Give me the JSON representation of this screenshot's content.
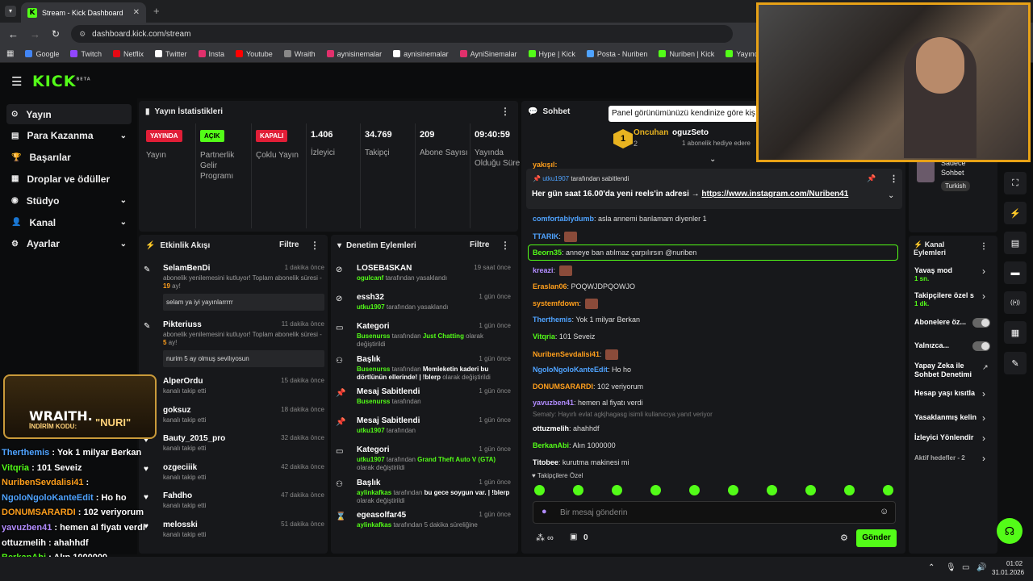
{
  "browser": {
    "tab_title": "Stream - Kick Dashboard",
    "url": "dashboard.kick.com/stream",
    "bookmarks": [
      "Google",
      "Twitch",
      "Netflix",
      "Twitter",
      "Insta",
      "Youtube",
      "Wraith",
      "aynisinemalar",
      "aynisinemalar",
      "AyniSinemalar",
      "Hype | Kick",
      "Posta - Nuriben",
      "Nuriben | Kick",
      "Yayıncı Paneli | Kick"
    ]
  },
  "brand": "KICK",
  "brand_sup": "BETA",
  "nav": [
    "Yayın",
    "Para Kazanma",
    "Başarılar",
    "Droplar ve ödüller",
    "Stüdyo",
    "Kanal",
    "Ayarlar"
  ],
  "stats": {
    "title": "Yayın İstatistikleri",
    "items": [
      {
        "badge": "YAYINDA",
        "label": "Yayın",
        "color": "#e01e37"
      },
      {
        "badge": "AÇIK",
        "label": "Partnerlik Gelir Programı",
        "color": "#53fc18"
      },
      {
        "badge": "KAPALI",
        "label": "Çoklu Yayın",
        "color": "#e01e37"
      },
      {
        "value": "1.406",
        "label": "İzleyici"
      },
      {
        "value": "34.769",
        "label": "Takipçi"
      },
      {
        "value": "209",
        "label": "Abone Sayısı"
      },
      {
        "value": "09:40:59",
        "label": "Yayında Olduğu Süre"
      }
    ]
  },
  "activity": {
    "title": "Etkinlik Akışı",
    "filter": "Filtre",
    "items": [
      {
        "name": "SelamBenDi",
        "time": "1 dakika önce",
        "sub": "abonelik yenilemesini kutluyor! Toplam abonelik süresi - ",
        "months": "19",
        "suffix": " ay!",
        "msg": "selam ya iyi yayınlarrrrr"
      },
      {
        "name": "Pikteriuss",
        "time": "11 dakika önce",
        "sub": "abonelik yenilemesini kutluyor! Toplam abonelik süresi - ",
        "months": "5",
        "suffix": " ay!",
        "msg": "nurim 5 ay olmuş sevilıyosun"
      },
      {
        "name": "AlperOrdu",
        "time": "15 dakika önce",
        "sub": "kanalı takip etti"
      },
      {
        "name": "goksuz",
        "time": "18 dakika önce",
        "sub": "kanalı takip etti"
      },
      {
        "name": "Bauty_2015_pro",
        "time": "32 dakika önce",
        "sub": "kanalı takip etti"
      },
      {
        "name": "ozgeciiik",
        "time": "42 dakika önce",
        "sub": "kanalı takip etti"
      },
      {
        "name": "Fahdho",
        "time": "47 dakika önce",
        "sub": "kanalı takip etti"
      },
      {
        "name": "melosski",
        "time": "51 dakika önce",
        "sub": "kanalı takip etti"
      }
    ]
  },
  "moderation": {
    "title": "Denetim Eylemleri",
    "filter": "Filtre",
    "items": [
      {
        "title": "LOSEB4SKAN",
        "time": "19 saat önce",
        "actor": "ogulcanf",
        "text": " tarafından yasaklandı"
      },
      {
        "title": "essh32",
        "time": "1 gün önce",
        "actor": "utku1907",
        "text": " tarafından yasaklandı"
      },
      {
        "title": "Kategori",
        "time": "1 gün önce",
        "actor": "Busenurss",
        "text": " tarafından ",
        "hl": "Just Chatting",
        "text2": " olarak değiştirildi"
      },
      {
        "title": "Başlık",
        "time": "1 gün önce",
        "actor": "Busenurss",
        "text": " tarafından ",
        "bold": "Memleketin kaderi bu dörtlünün ellerinde! | !blerp",
        "text2": " olarak değiştirildi"
      },
      {
        "title": "Mesaj Sabitlendi",
        "time": "1 gün önce",
        "actor": "Busenurss",
        "text": " tarafından"
      },
      {
        "title": "Mesaj Sabitlendi",
        "time": "1 gün önce",
        "actor": "utku1907",
        "text": " tarafından"
      },
      {
        "title": "Kategori",
        "time": "1 gün önce",
        "actor": "utku1907",
        "text": " tarafından ",
        "hl": "Grand Theft Auto V (GTA)",
        "text2": " olarak değiştirildi"
      },
      {
        "title": "Başlık",
        "time": "1 gün önce",
        "actor": "aylinkafkas",
        "text": " tarafından ",
        "bold": "bu gece soygun var. | !blerp",
        "text2": " olarak değiştirildi"
      },
      {
        "title": "egeasolfar45",
        "time": "1 gün önce",
        "actor": "aylinkafkas",
        "text": " tarafından 5 dakika süreliğine"
      }
    ]
  },
  "chat": {
    "title": "Sohbet",
    "tooltip": "Panel görünümünüzü kendinize göre kiş",
    "top_user": "Oncuhan",
    "top_count": "2",
    "gifter": "oguzSeto",
    "gift_text": "1 abonelik hediye edere",
    "pinned_by": "utku1907",
    "pinned_by_text": " tarafından sabitlendi",
    "pinned_text": "Her gün saat 16.00'da yeni reels'in adresi → ",
    "pinned_link": "https://www.instagram.com/Nuriben41",
    "top_partial": "yakışıl:",
    "messages": [
      {
        "user": "comfortabiydumb",
        "color": "#4fa3ff",
        "text": "asla annemi banlamam diyenler 1"
      },
      {
        "user": "TTARIK",
        "color": "#4fa3ff",
        "text": ""
      },
      {
        "user": "Beorn35",
        "color": "#53fc18",
        "text": "anneye ban atılmaz çarpılırsın @nuriben"
      },
      {
        "user": "kreazi",
        "color": "#b28cff",
        "text": ""
      },
      {
        "user": "Eraslan06",
        "color": "#ff9f1c",
        "text": "POQWJDPQOWJO"
      },
      {
        "user": "systemfdown",
        "color": "#ff9f1c",
        "text": ""
      },
      {
        "user": "Therthemis",
        "color": "#4fa3ff",
        "text": "Yok 1 milyar Berkan"
      },
      {
        "user": "Vitqria",
        "color": "#53fc18",
        "text": "101 Seveiz"
      },
      {
        "user": "NuribenSevdalisi41",
        "color": "#ff9f1c",
        "text": ""
      },
      {
        "user": "NgoloNgoloKanteEdit",
        "color": "#4fa3ff",
        "text": "Ho ho"
      },
      {
        "user": "DONUMSARARDI",
        "color": "#ff9f1c",
        "text": "102 veriyorum"
      },
      {
        "user": "yavuzben41",
        "color": "#b28cff",
        "text": "hemen al fiyatı verdi"
      },
      {
        "user": "ottuzmelih",
        "color": "#fff",
        "text": "ahahhdf",
        "reply": "Sematy: Hayırlı evlat agkjhagasg isimli kullanıcıya yanıt veriyor"
      },
      {
        "user": "BerkanAbi",
        "color": "#53fc18",
        "text": "Alın 1000000"
      },
      {
        "user": "Titobee",
        "color": "#fff",
        "text": "kurutma makinesi mi"
      }
    ],
    "followers_only": "Takipçilere Özel",
    "input_placeholder": "Bir mesaj gönderin",
    "count": "0",
    "send": "Gönder"
  },
  "right_panel": {
    "language": "Turkish",
    "partial_top": "Sadece Sohbet",
    "actions_title": "Kanal Eylemleri",
    "items": [
      {
        "label": "Yavaş mod",
        "sub": "1 sn."
      },
      {
        "label": "Takipçilere özel s",
        "sub": "1 dk."
      },
      {
        "label": "Abonelere öz..."
      },
      {
        "label": "Yalnızca..."
      },
      {
        "label": "Yapay Zeka ile Sohbet Denetimi"
      },
      {
        "label": "Hesap yaşı kısıtla"
      },
      {
        "label": "Yasaklanmış kelin"
      },
      {
        "label": "İzleyici Yönlendir"
      },
      {
        "label": "Aktif hedefler - 2"
      }
    ]
  },
  "overlay": {
    "brand": "WRAITH.",
    "code_label": "İNDİRİM KODU:",
    "code": "\"NURI\"",
    "lines": [
      {
        "u": "Therthemis",
        "t": " : Yok 1 milyar Berkan"
      },
      {
        "u": "Vitqria",
        "t": " : 101 Seveiz"
      },
      {
        "u": "NuribenSevdalisi41",
        "t": " :"
      },
      {
        "u": "NgoloNgoloKanteEdit",
        "t": " : Ho ho"
      },
      {
        "u": "DONUMSARARDI",
        "t": " : 102 veriyorum"
      },
      {
        "u": "yavuzben41",
        "t": " : hemen al fiyatı verdi"
      },
      {
        "u": "ottuzmelih",
        "t": " : ahahhdf"
      },
      {
        "u": "BerkanAbi",
        "t": " : Alın 1000000"
      },
      {
        "u": "Titobee",
        "t": " : kurutma makinesi mi"
      }
    ]
  },
  "taskbar": {
    "time": "01:02",
    "date": "31.01.2026"
  }
}
